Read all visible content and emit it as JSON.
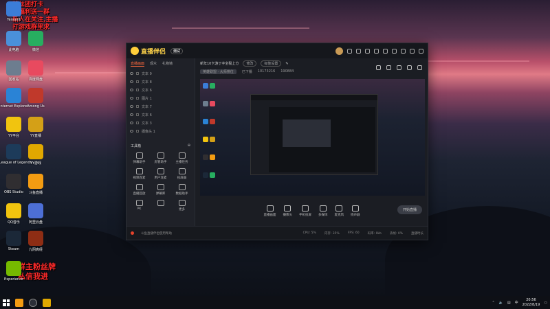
{
  "overlay": {
    "top_lines": [
      "粉丝团打卡",
      "有福利送一群",
      "新人在关注,主播",
      "打游戏群里求"
    ],
    "bottom_lines": [
      "群主粉丝牌",
      "私信我进"
    ]
  },
  "desktop_icons": [
    {
      "label": "Tencent",
      "icon": "person-icon",
      "color": "#3b7dd8"
    },
    {
      "label": "此电脑",
      "icon": "computer-icon",
      "color": "#4a90d9"
    },
    {
      "label": "微信",
      "icon": "wechat-icon",
      "color": "#27ae60"
    },
    {
      "label": "回收站",
      "icon": "recycle-bin-icon",
      "color": "#6d7d8f"
    },
    {
      "label": "百度网盘",
      "icon": "cloud-icon",
      "color": "#e84a5f"
    },
    {
      "label": "Internet Explorer",
      "icon": "ie-icon",
      "color": "#2a83d6"
    },
    {
      "label": "Among Us",
      "icon": "among-us-icon",
      "color": "#c0392b"
    },
    {
      "label": "YY平台",
      "icon": "yy-icon",
      "color": "#f1c40f"
    },
    {
      "label": "YY直播",
      "icon": "yy-live-icon",
      "color": "#d4a017"
    },
    {
      "label": "League of Legends",
      "icon": "lol-icon",
      "color": "#1d3b5a"
    },
    {
      "label": "YY游戏",
      "icon": "yy-game-icon",
      "color": "#e0a800"
    },
    {
      "label": "OBS Studio",
      "icon": "obs-icon",
      "color": "#302e31"
    },
    {
      "label": "斗鱼直播",
      "icon": "douyu-icon",
      "color": "#f39c12"
    },
    {
      "label": "QQ音乐",
      "icon": "qq-music-icon",
      "color": "#f1c40f"
    },
    {
      "label": "阿里云盘",
      "icon": "aliyun-icon",
      "color": "#4d6fd6"
    },
    {
      "label": "Steam",
      "icon": "steam-icon",
      "color": "#1b2838"
    },
    {
      "label": "九阴真经",
      "icon": "game-icon",
      "color": "#8e2d14"
    },
    {
      "label": "Experience",
      "icon": "experience-icon",
      "color": "#76b900"
    }
  ],
  "app": {
    "title": "直播伴侣",
    "version": "测试",
    "sidebar_tabs": [
      "直播画面",
      "观众",
      "礼物墙"
    ],
    "scene_items": [
      "文本 9",
      "文本 8",
      "文本 6",
      "图片 1",
      "文本 7",
      "文本 6",
      "文本 3",
      "摄像头 1"
    ],
    "tools_header": "工具箱",
    "tools": [
      "弹幕助手",
      "房管助手",
      "主播任务",
      "视频连麦",
      "用户连麦",
      "投屏器",
      "直播回放",
      "弹幕库",
      "数据助手",
      "PK",
      "",
      "更多"
    ],
    "main_title": "新年10卡游丁字全裂上分",
    "main_pill": "修改",
    "main_pill2": "标签设置",
    "tag": "英雄联盟 · 大师排位",
    "meta": [
      "已下播",
      "10173216",
      "190884"
    ],
    "bottom_tools": [
      "直播画面",
      "摄像头",
      "手机投屏",
      "多媒体",
      "麦克风",
      "扬声器"
    ],
    "start_label": "开始直播",
    "status_text": "斗鱼直播伴侣使用帮助",
    "stats": [
      "CPU: 5%",
      "内存: 35%",
      "FPS: 60",
      "码率: 0kb",
      "丢帧: 0%",
      "直播时长"
    ]
  },
  "taskbar": {
    "time": "20:56",
    "date": "2022/8/19",
    "lang": "中"
  }
}
